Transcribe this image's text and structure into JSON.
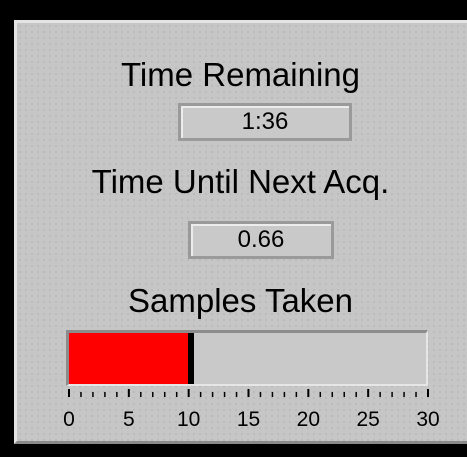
{
  "time_remaining": {
    "label": "Time Remaining",
    "value": "1:36"
  },
  "time_until_next": {
    "label": "Time Until Next Acq.",
    "value": "0.66"
  },
  "samples": {
    "label": "Samples Taken",
    "value": 10,
    "min": 0,
    "max": 30,
    "fill_color": "#ff0000",
    "ticks": [
      "0",
      "5",
      "10",
      "15",
      "20",
      "25",
      "30"
    ]
  }
}
